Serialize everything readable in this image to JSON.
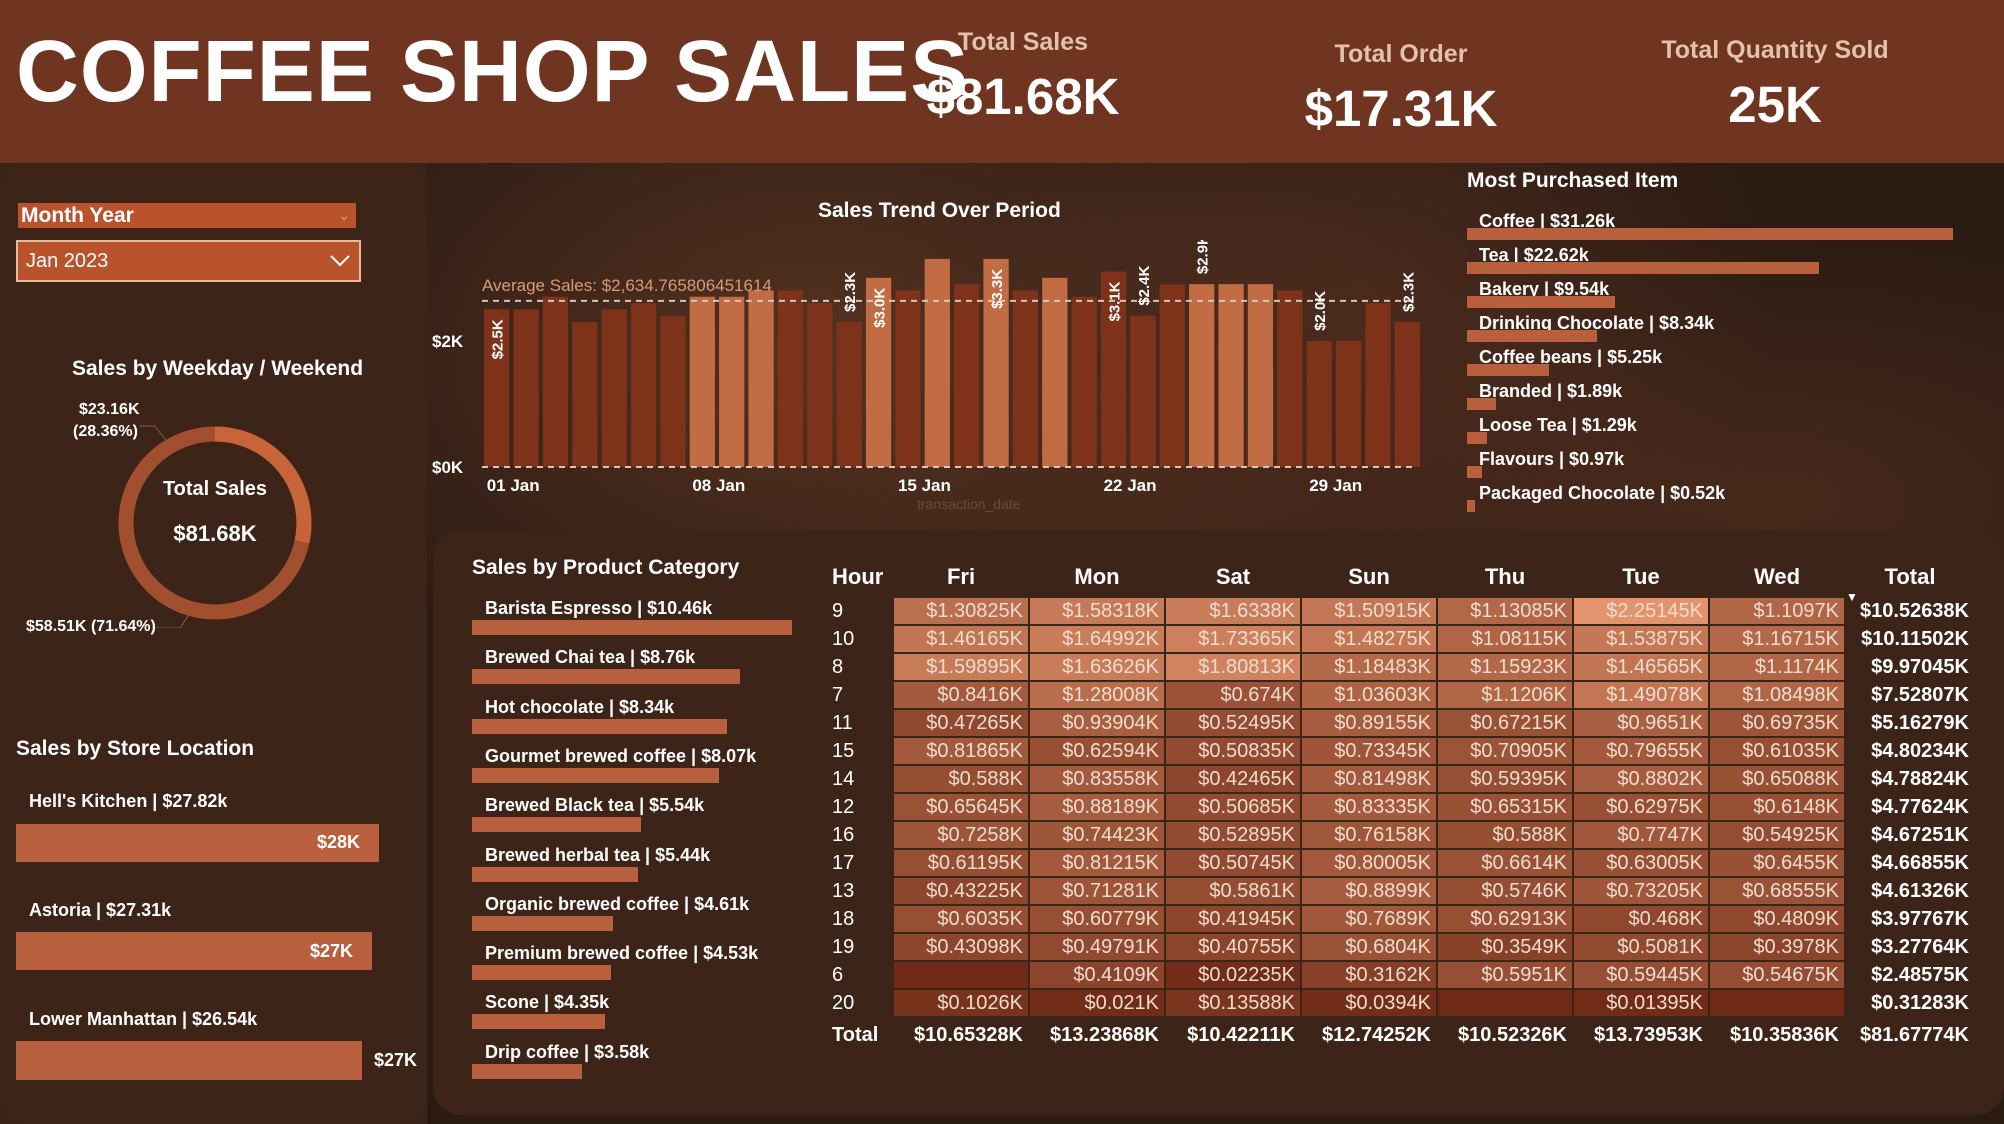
{
  "header": {
    "title": "COFFEE SHOP SALES",
    "kpis": [
      {
        "label": "Total Sales",
        "value": "$81.68K"
      },
      {
        "label": "Total Order",
        "value": "$17.31K"
      },
      {
        "label": "Total Quantity Sold",
        "value": "25K"
      }
    ]
  },
  "slicer": {
    "title": "Month Year",
    "selected": "Jan 2023"
  },
  "weekday_donut": {
    "title": "Sales by Weekday / Weekend",
    "center_label": "Total Sales",
    "center_value": "$81.68K",
    "top_label": "$23.16K",
    "top_pct": "(28.36%)",
    "bottom_label": "$58.51K (71.64%)",
    "share_top": 0.2836,
    "share_bottom": 0.7164
  },
  "store": {
    "title": "Sales by Store Location",
    "items": [
      {
        "label": "Hell's Kitchen | $27.82k",
        "value_label": "$28K",
        "value": 27.82
      },
      {
        "label": "Astoria | $27.31k",
        "value_label": "$27K",
        "value": 27.31
      },
      {
        "label": "Lower Manhattan | $26.54k",
        "value_label": "$27K",
        "value": 26.54
      }
    ]
  },
  "trend": {
    "title": "Sales Trend Over Period",
    "avg_label": "Average Sales: $2,634.765806451614",
    "x_axis_name": "transaction_date"
  },
  "chart_data": {
    "type": "bar",
    "title": "Sales Trend Over Period",
    "x": [
      "01 Jan",
      "02 Jan",
      "03 Jan",
      "04 Jan",
      "05 Jan",
      "06 Jan",
      "07 Jan",
      "08 Jan",
      "09 Jan",
      "10 Jan",
      "11 Jan",
      "12 Jan",
      "13 Jan",
      "14 Jan",
      "15 Jan",
      "16 Jan",
      "17 Jan",
      "18 Jan",
      "19 Jan",
      "20 Jan",
      "21 Jan",
      "22 Jan",
      "23 Jan",
      "24 Jan",
      "25 Jan",
      "26 Jan",
      "27 Jan",
      "28 Jan",
      "29 Jan",
      "30 Jan",
      "31 Jan"
    ],
    "x_tick_labels": [
      "01 Jan",
      "08 Jan",
      "15 Jan",
      "22 Jan",
      "29 Jan"
    ],
    "values": [
      2.5,
      2.5,
      2.7,
      2.3,
      2.5,
      2.6,
      2.4,
      2.7,
      2.7,
      2.8,
      2.8,
      2.6,
      2.3,
      3.0,
      2.8,
      3.3,
      2.9,
      3.3,
      2.8,
      3.0,
      2.7,
      3.1,
      2.4,
      2.9,
      2.9,
      2.9,
      2.9,
      2.8,
      2.0,
      2.0,
      2.6,
      2.3
    ],
    "light_indices": [
      7,
      8,
      9,
      13,
      15,
      17,
      19,
      24,
      25,
      26
    ],
    "data_labels": {
      "0": "$2.5K",
      "12": "$2.3K",
      "13": "$3.0K",
      "17": "$3.3K",
      "21": "$3.1K",
      "22": "$2.4K",
      "24": "$2.9K",
      "28": "$2.0K",
      "31": "$2.3K"
    },
    "average": 2.634765806451614,
    "y_ticks": [
      {
        "v": 0,
        "label": "$0K"
      },
      {
        "v": 2,
        "label": "$2K"
      }
    ],
    "ylim": [
      0,
      3.6
    ],
    "ylabel": "",
    "xlabel": "transaction_date",
    "colors": {
      "dark": "#7d3219",
      "light": "#c26c44"
    }
  },
  "most_purchased": {
    "title": "Most Purchased Item",
    "items": [
      {
        "label": "Coffee | $31.26k",
        "value": 31.26
      },
      {
        "label": "Tea | $22.62k",
        "value": 22.62
      },
      {
        "label": "Bakery | $9.54k",
        "value": 9.54
      },
      {
        "label": "Drinking Chocolate | $8.34k",
        "value": 8.34
      },
      {
        "label": "Coffee beans | $5.25k",
        "value": 5.25
      },
      {
        "label": "Branded | $1.89k",
        "value": 1.89
      },
      {
        "label": "Loose Tea | $1.29k",
        "value": 1.29
      },
      {
        "label": "Flavours | $0.97k",
        "value": 0.97
      },
      {
        "label": "Packaged Chocolate | $0.52k",
        "value": 0.52
      }
    ]
  },
  "product_category": {
    "title": "Sales by Product Category",
    "items": [
      {
        "label": "Barista Espresso | $10.46k",
        "value": 10.46
      },
      {
        "label": "Brewed Chai tea | $8.76k",
        "value": 8.76
      },
      {
        "label": "Hot chocolate | $8.34k",
        "value": 8.34
      },
      {
        "label": "Gourmet brewed coffee | $8.07k",
        "value": 8.07
      },
      {
        "label": "Brewed Black tea | $5.54k",
        "value": 5.54
      },
      {
        "label": "Brewed herbal tea | $5.44k",
        "value": 5.44
      },
      {
        "label": "Organic brewed coffee | $4.61k",
        "value": 4.61
      },
      {
        "label": "Premium brewed coffee | $4.53k",
        "value": 4.53
      },
      {
        "label": "Scone | $4.35k",
        "value": 4.35
      },
      {
        "label": "Drip coffee | $3.58k",
        "value": 3.58
      }
    ]
  },
  "matrix": {
    "headers": [
      "Hour",
      "Fri",
      "Mon",
      "Sat",
      "Sun",
      "Thu",
      "Tue",
      "Wed",
      "Total"
    ],
    "sort_icon": "sort-desc-icon",
    "rows": [
      {
        "hour": "9",
        "cells": [
          "$1.30825K",
          "$1.58318K",
          "$1.6338K",
          "$1.50915K",
          "$1.13085K",
          "$2.25145K",
          "$1.1097K"
        ],
        "v": [
          1.308,
          1.583,
          1.634,
          1.509,
          1.131,
          2.251,
          1.11
        ],
        "total": "$10.52638K"
      },
      {
        "hour": "10",
        "cells": [
          "$1.46165K",
          "$1.64992K",
          "$1.73365K",
          "$1.48275K",
          "$1.08115K",
          "$1.53875K",
          "$1.16715K"
        ],
        "v": [
          1.462,
          1.65,
          1.734,
          1.483,
          1.081,
          1.539,
          1.167
        ],
        "total": "$10.11502K"
      },
      {
        "hour": "8",
        "cells": [
          "$1.59895K",
          "$1.63626K",
          "$1.80813K",
          "$1.18483K",
          "$1.15923K",
          "$1.46565K",
          "$1.1174K"
        ],
        "v": [
          1.599,
          1.636,
          1.808,
          1.185,
          1.159,
          1.466,
          1.117
        ],
        "total": "$9.97045K"
      },
      {
        "hour": "7",
        "cells": [
          "$0.8416K",
          "$1.28008K",
          "$0.674K",
          "$1.03603K",
          "$1.1206K",
          "$1.49078K",
          "$1.08498K"
        ],
        "v": [
          0.842,
          1.28,
          0.674,
          1.036,
          1.121,
          1.491,
          1.085
        ],
        "total": "$7.52807K"
      },
      {
        "hour": "11",
        "cells": [
          "$0.47265K",
          "$0.93904K",
          "$0.52495K",
          "$0.89155K",
          "$0.67215K",
          "$0.9651K",
          "$0.69735K"
        ],
        "v": [
          0.473,
          0.939,
          0.525,
          0.892,
          0.672,
          0.965,
          0.697
        ],
        "total": "$5.16279K"
      },
      {
        "hour": "15",
        "cells": [
          "$0.81865K",
          "$0.62594K",
          "$0.50835K",
          "$0.73345K",
          "$0.70905K",
          "$0.79655K",
          "$0.61035K"
        ],
        "v": [
          0.819,
          0.626,
          0.508,
          0.733,
          0.709,
          0.797,
          0.61
        ],
        "total": "$4.80234K"
      },
      {
        "hour": "14",
        "cells": [
          "$0.588K",
          "$0.83558K",
          "$0.42465K",
          "$0.81498K",
          "$0.59395K",
          "$0.8802K",
          "$0.65088K"
        ],
        "v": [
          0.588,
          0.836,
          0.425,
          0.815,
          0.594,
          0.88,
          0.651
        ],
        "total": "$4.78824K"
      },
      {
        "hour": "12",
        "cells": [
          "$0.65645K",
          "$0.88189K",
          "$0.50685K",
          "$0.83335K",
          "$0.65315K",
          "$0.62975K",
          "$0.6148K"
        ],
        "v": [
          0.656,
          0.882,
          0.507,
          0.833,
          0.653,
          0.63,
          0.615
        ],
        "total": "$4.77624K"
      },
      {
        "hour": "16",
        "cells": [
          "$0.7258K",
          "$0.74423K",
          "$0.52895K",
          "$0.76158K",
          "$0.588K",
          "$0.7747K",
          "$0.54925K"
        ],
        "v": [
          0.726,
          0.744,
          0.529,
          0.762,
          0.588,
          0.775,
          0.549
        ],
        "total": "$4.67251K"
      },
      {
        "hour": "17",
        "cells": [
          "$0.61195K",
          "$0.81215K",
          "$0.50745K",
          "$0.80005K",
          "$0.6614K",
          "$0.63005K",
          "$0.6455K"
        ],
        "v": [
          0.612,
          0.812,
          0.507,
          0.8,
          0.661,
          0.63,
          0.646
        ],
        "total": "$4.66855K"
      },
      {
        "hour": "13",
        "cells": [
          "$0.43225K",
          "$0.71281K",
          "$0.5861K",
          "$0.8899K",
          "$0.5746K",
          "$0.73205K",
          "$0.68555K"
        ],
        "v": [
          0.432,
          0.713,
          0.586,
          0.89,
          0.575,
          0.732,
          0.686
        ],
        "total": "$4.61326K"
      },
      {
        "hour": "18",
        "cells": [
          "$0.6035K",
          "$0.60779K",
          "$0.41945K",
          "$0.7689K",
          "$0.62913K",
          "$0.468K",
          "$0.4809K"
        ],
        "v": [
          0.604,
          0.608,
          0.419,
          0.769,
          0.629,
          0.468,
          0.481
        ],
        "total": "$3.97767K"
      },
      {
        "hour": "19",
        "cells": [
          "$0.43098K",
          "$0.49791K",
          "$0.40755K",
          "$0.6804K",
          "$0.3549K",
          "$0.5081K",
          "$0.3978K"
        ],
        "v": [
          0.431,
          0.498,
          0.408,
          0.68,
          0.355,
          0.508,
          0.398
        ],
        "total": "$3.27764K"
      },
      {
        "hour": "6",
        "cells": [
          "",
          "$0.4109K",
          "$0.02235K",
          "$0.3162K",
          "$0.5951K",
          "$0.59445K",
          "$0.54675K"
        ],
        "v": [
          0,
          0.411,
          0.022,
          0.316,
          0.595,
          0.594,
          0.547
        ],
        "total": "$2.48575K"
      },
      {
        "hour": "20",
        "cells": [
          "$0.1026K",
          "$0.021K",
          "$0.13588K",
          "$0.0394K",
          "",
          "$0.01395K",
          ""
        ],
        "v": [
          0.103,
          0.021,
          0.136,
          0.039,
          0,
          0.014,
          0
        ],
        "total": "$0.31283K"
      }
    ],
    "total_row": {
      "label": "Total",
      "cells": [
        "$10.65328K",
        "$13.23868K",
        "$10.42211K",
        "$12.74252K",
        "$10.52326K",
        "$13.73953K",
        "$10.35836K"
      ],
      "total": "$81.67774K"
    },
    "colors": {
      "low": "#6e2a16",
      "high": "#e3946c"
    }
  },
  "colors": {
    "accent": "#b8603e",
    "header": "#6f3520",
    "panel": "#3d2418"
  }
}
